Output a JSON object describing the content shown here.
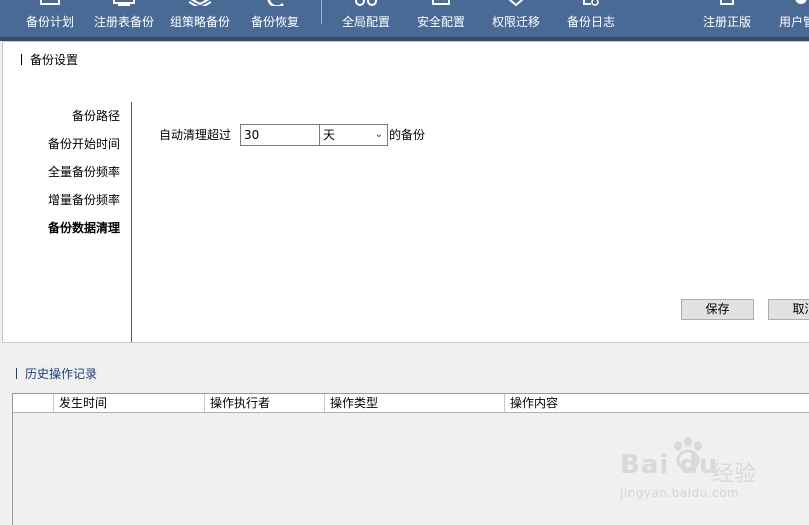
{
  "toolbar": {
    "items": [
      {
        "label": "备份计划",
        "icon": "calendar-icon"
      },
      {
        "label": "注册表备份",
        "icon": "registry-icon"
      },
      {
        "label": "组策略备份",
        "icon": "layers-icon"
      },
      {
        "label": "备份恢复",
        "icon": "restore-icon"
      },
      {
        "label": "全局配置",
        "icon": "global-config-icon"
      },
      {
        "label": "安全配置",
        "icon": "security-icon"
      },
      {
        "label": "权限迁移",
        "icon": "permission-migrate-icon"
      },
      {
        "label": "备份日志",
        "icon": "log-icon"
      },
      {
        "label": "注册正版",
        "icon": "register-icon"
      },
      {
        "label": "用户管",
        "icon": "user-icon"
      }
    ]
  },
  "settings": {
    "title": "备份设置",
    "nav": [
      {
        "label": "备份路径",
        "active": false
      },
      {
        "label": "备份开始时间",
        "active": false
      },
      {
        "label": "全量备份频率",
        "active": false
      },
      {
        "label": "增量备份频率",
        "active": false
      },
      {
        "label": "备份数据清理",
        "active": true
      }
    ],
    "cleanup": {
      "prefix": "自动清理超过",
      "value": "30",
      "unit": "天",
      "suffix": "的备份"
    },
    "save_label": "保存",
    "cancel_label": "取消"
  },
  "history": {
    "title": "历史操作记录",
    "columns": [
      "",
      "发生时间",
      "操作执行者",
      "操作类型",
      "操作内容"
    ]
  },
  "watermark": {
    "logo": "Bai du",
    "cn": "经验",
    "url": "jingyan.baidu.com"
  },
  "colors": {
    "toolbar": "#4a6a96",
    "history_title": "#1a3f7a"
  }
}
